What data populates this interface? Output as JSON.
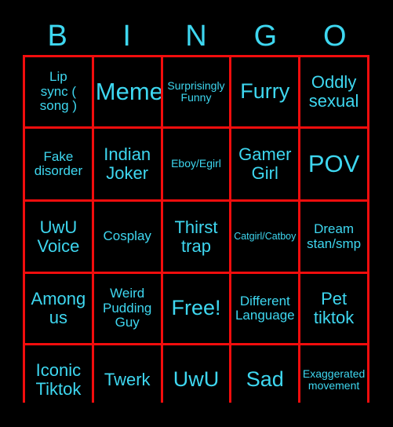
{
  "card": {
    "title": "BINGO",
    "accent_text_color": "#3ed7f0",
    "grid_line_color": "#f20d0d",
    "background_color": "#000000",
    "columns": 5,
    "rows": 5
  },
  "header": {
    "letters": [
      "B",
      "I",
      "N",
      "G",
      "O"
    ]
  },
  "cells": [
    {
      "text": "Lip\nsync (\nsong )",
      "size": "sm",
      "free": false
    },
    {
      "text": "Meme",
      "size": "xl",
      "free": false
    },
    {
      "text": "Surprisingly\nFunny",
      "size": "xs",
      "free": false
    },
    {
      "text": "Furry",
      "size": "lg",
      "free": false
    },
    {
      "text": "Oddly\nsexual",
      "size": "md",
      "free": false
    },
    {
      "text": "Fake\ndisorder",
      "size": "sm",
      "free": false
    },
    {
      "text": "Indian\nJoker",
      "size": "md",
      "free": false
    },
    {
      "text": "Eboy/Egirl",
      "size": "xs",
      "free": false
    },
    {
      "text": "Gamer\nGirl",
      "size": "md",
      "free": false
    },
    {
      "text": "POV",
      "size": "xl",
      "free": false
    },
    {
      "text": "UwU\nVoice",
      "size": "md",
      "free": false
    },
    {
      "text": "Cosplay",
      "size": "sm",
      "free": false
    },
    {
      "text": "Thirst\ntrap",
      "size": "md",
      "free": false
    },
    {
      "text": "Catgirl/Catboy",
      "size": "xxs",
      "free": false
    },
    {
      "text": "Dream\nstan/smp",
      "size": "sm",
      "free": false
    },
    {
      "text": "Among\nus",
      "size": "md",
      "free": false
    },
    {
      "text": "Weird\nPudding\nGuy",
      "size": "sm",
      "free": false
    },
    {
      "text": "Free!",
      "size": "lg",
      "free": true
    },
    {
      "text": "Different\nLanguage",
      "size": "sm",
      "free": false
    },
    {
      "text": "Pet\ntiktok",
      "size": "md",
      "free": false
    },
    {
      "text": "Iconic\nTiktok",
      "size": "md",
      "free": false
    },
    {
      "text": "Twerk",
      "size": "md",
      "free": false
    },
    {
      "text": "UwU",
      "size": "lg",
      "free": false
    },
    {
      "text": "Sad",
      "size": "lg",
      "free": false
    },
    {
      "text": "Exaggerated\nmovement",
      "size": "xs",
      "free": false
    }
  ]
}
